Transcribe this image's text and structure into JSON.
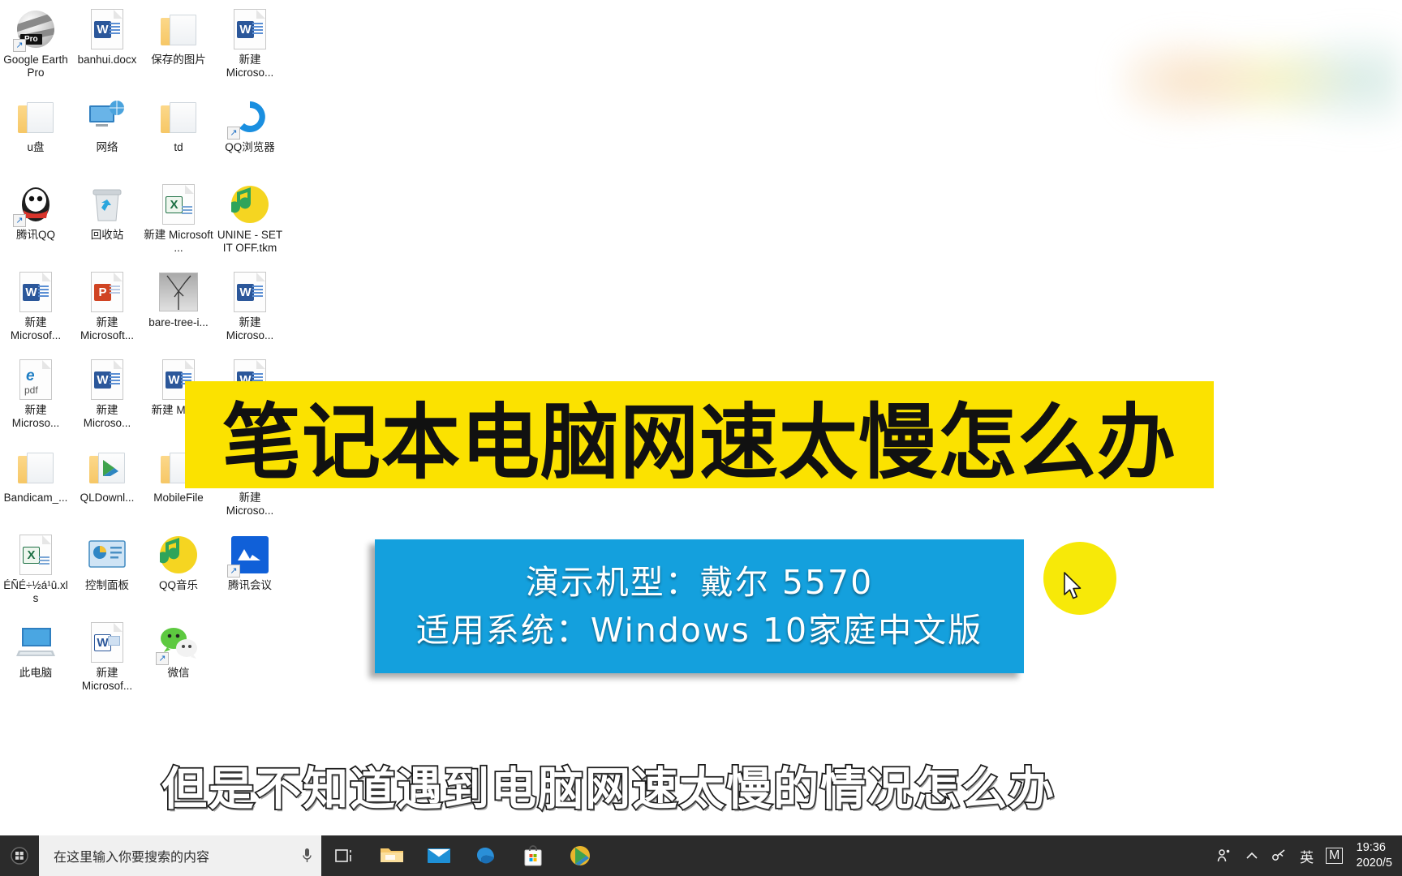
{
  "desktop": {
    "icons": [
      {
        "label": "Google Earth Pro",
        "icon": "google-earth-pro-icon",
        "kind": "earth"
      },
      {
        "label": "banhui.docx",
        "icon": "word-document-icon",
        "kind": "word"
      },
      {
        "label": "保存的图片",
        "icon": "folder-icon",
        "kind": "folder"
      },
      {
        "label": "新建 Microso...",
        "icon": "word-document-icon",
        "kind": "word"
      },
      {
        "label": "u盘",
        "icon": "folder-icon",
        "kind": "folder"
      },
      {
        "label": "网络",
        "icon": "network-icon",
        "kind": "network"
      },
      {
        "label": "td",
        "icon": "folder-icon",
        "kind": "folder"
      },
      {
        "label": "QQ浏览器",
        "icon": "qq-browser-icon",
        "kind": "qqbrowser"
      },
      {
        "label": "腾讯QQ",
        "icon": "tencent-qq-icon",
        "kind": "qq"
      },
      {
        "label": "回收站",
        "icon": "recycle-bin-icon",
        "kind": "recycle"
      },
      {
        "label": "新建 Microsoft ...",
        "icon": "excel-document-icon",
        "kind": "excel"
      },
      {
        "label": "UNINE - SET IT OFF.tkm",
        "icon": "qq-music-icon",
        "kind": "qqmusic"
      },
      {
        "label": "新建 Microsof...",
        "icon": "word-document-icon",
        "kind": "word"
      },
      {
        "label": "新建 Microsoft...",
        "icon": "powerpoint-document-icon",
        "kind": "ppt"
      },
      {
        "label": "bare-tree-i...",
        "icon": "image-thumbnail-icon",
        "kind": "tree"
      },
      {
        "label": "新建 Microso...",
        "icon": "word-document-icon",
        "kind": "word"
      },
      {
        "label": "新建 Microso...",
        "icon": "pdf-document-icon",
        "kind": "pdf"
      },
      {
        "label": "新建 Microso...",
        "icon": "word-document-icon",
        "kind": "word"
      },
      {
        "label": "新建 Micr...",
        "icon": "word-document-icon",
        "kind": "word"
      },
      {
        "label": "",
        "icon": "word-document-icon",
        "kind": "word"
      },
      {
        "label": "Bandicam_...",
        "icon": "folder-icon",
        "kind": "folder"
      },
      {
        "label": "QLDownl...",
        "icon": "folder-icon",
        "kind": "folderql"
      },
      {
        "label": "MobileFile",
        "icon": "folder-icon",
        "kind": "folder"
      },
      {
        "label": "新建 Microso...",
        "icon": "word-document-icon",
        "kind": "word"
      },
      {
        "label": "ÉÑÉ÷½á¹û.xls",
        "icon": "excel-document-icon",
        "kind": "excel"
      },
      {
        "label": "控制面板",
        "icon": "control-panel-icon",
        "kind": "controlpanel"
      },
      {
        "label": "QQ音乐",
        "icon": "qq-music-icon",
        "kind": "qqmusic"
      },
      {
        "label": "腾讯会议",
        "icon": "tencent-meeting-icon",
        "kind": "meeting"
      },
      {
        "label": "此电脑",
        "icon": "this-pc-icon",
        "kind": "thispc"
      },
      {
        "label": "新建 Microsof...",
        "icon": "word-image-document-icon",
        "kind": "wordimg"
      },
      {
        "label": "微信",
        "icon": "wechat-icon",
        "kind": "wechat"
      }
    ]
  },
  "overlay": {
    "title": "笔记本电脑网速太慢怎么办",
    "title_bg_color": "#fbe200",
    "info_box_color": "#14a0dd",
    "info_lines": [
      "演示机型：戴尔 5570",
      "适用系统：Windows 10家庭中文版"
    ],
    "subtitle": "但是不知道遇到电脑网速太慢的情况怎么办",
    "cursor_highlight_color": "#f7e908"
  },
  "taskbar": {
    "start_label": "start-button",
    "search_placeholder": "在这里输入你要搜索的内容",
    "pinned": [
      {
        "name": "task-view-icon",
        "label": "任务视图"
      },
      {
        "name": "file-explorer-icon",
        "label": "文件资源管理器"
      },
      {
        "name": "mail-icon",
        "label": "邮件"
      },
      {
        "name": "edge-browser-icon",
        "label": "Microsoft Edge"
      },
      {
        "name": "microsoft-store-icon",
        "label": "Microsoft Store"
      },
      {
        "name": "play-store-icon",
        "label": "应用商店"
      }
    ],
    "tray": [
      {
        "name": "people-icon",
        "glyph": "\u0000"
      },
      {
        "name": "show-hidden-icons-chevron",
        "glyph": "∧"
      },
      {
        "name": "network-tray-icon",
        "glyph": "\u0000"
      },
      {
        "name": "ime-language-indicator",
        "glyph": "英"
      },
      {
        "name": "ime-mode-indicator",
        "glyph": "M"
      }
    ],
    "clock_time": "19:36",
    "clock_date": "2020/5"
  }
}
